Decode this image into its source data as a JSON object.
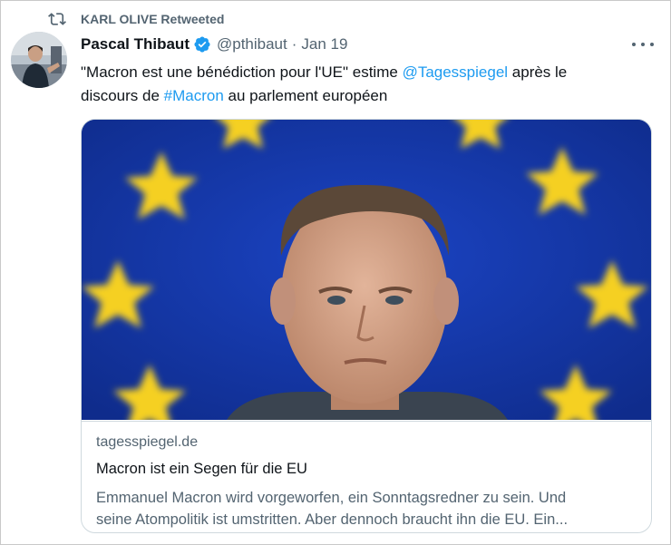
{
  "retweet": {
    "text": "KARL OLIVE Retweeted",
    "icon": "retweet-icon"
  },
  "author": {
    "name": "Pascal Thibaut",
    "handle": "@pthibaut",
    "separator": "·",
    "date": "Jan 19",
    "verified": true
  },
  "tweet": {
    "line1_prefix": "\"Macron est une bénédiction pour l'UE\" estime ",
    "mention": "@Tagesspiegel",
    "line1_suffix": " après le",
    "line2_prefix": "discours de ",
    "hashtag": "#Macron",
    "line2_suffix": " au parlement européen"
  },
  "card": {
    "domain": "tagesspiegel.de",
    "title": "Macron ist ein Segen für die EU",
    "description_line1": "Emmanuel Macron wird vorgeworfen, ein Sonntagsredner zu sein. Und",
    "description_line2": "seine Atompolitik ist umstritten. Aber dennoch braucht ihn die EU. Ein..."
  },
  "colors": {
    "accent": "#1d9bf0",
    "secondary_text": "#536471",
    "eu_blue": "#1537a8",
    "eu_star": "#f5d020"
  }
}
